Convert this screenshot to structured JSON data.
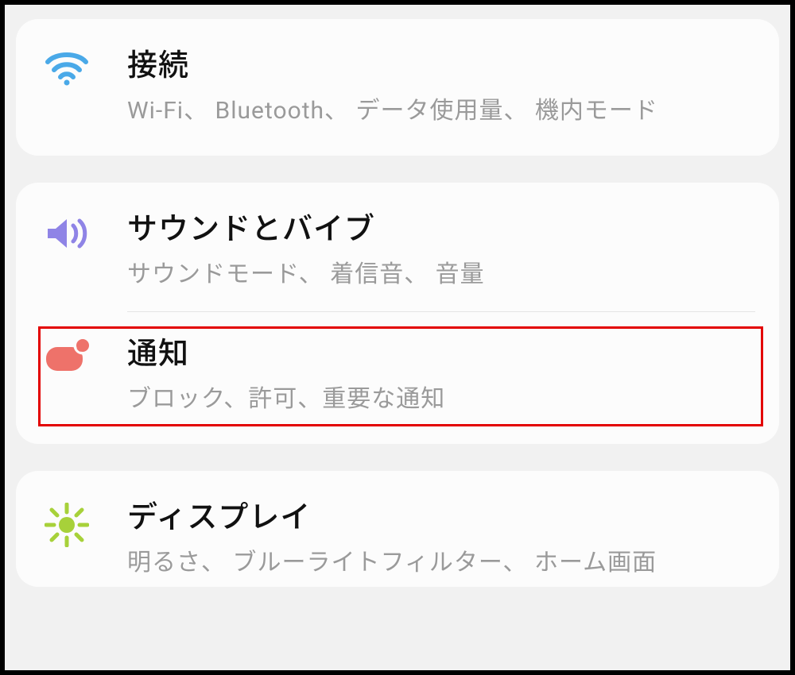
{
  "settings": {
    "groups": [
      {
        "items": [
          {
            "id": "connections",
            "icon": "wifi-icon",
            "iconColor": "#4aa9e8",
            "title": "接続",
            "subtitle": "Wi-Fi、 Bluetooth、 データ使用量、 機内モード",
            "highlighted": false
          }
        ]
      },
      {
        "items": [
          {
            "id": "sound",
            "icon": "speaker-icon",
            "iconColor": "#8f84e6",
            "title": "サウンドとバイブ",
            "subtitle": "サウンドモード、 着信音、 音量",
            "highlighted": false
          },
          {
            "id": "notifications",
            "icon": "notification-icon",
            "iconColor": "#ee726a",
            "title": "通知",
            "subtitle": "ブロック、許可、重要な通知",
            "highlighted": true
          }
        ]
      },
      {
        "items": [
          {
            "id": "display",
            "icon": "brightness-icon",
            "iconColor": "#a7d13a",
            "title": "ディスプレイ",
            "subtitle": "明るさ、 ブルーライトフィルター、 ホーム画面",
            "highlighted": false
          }
        ]
      }
    ]
  }
}
